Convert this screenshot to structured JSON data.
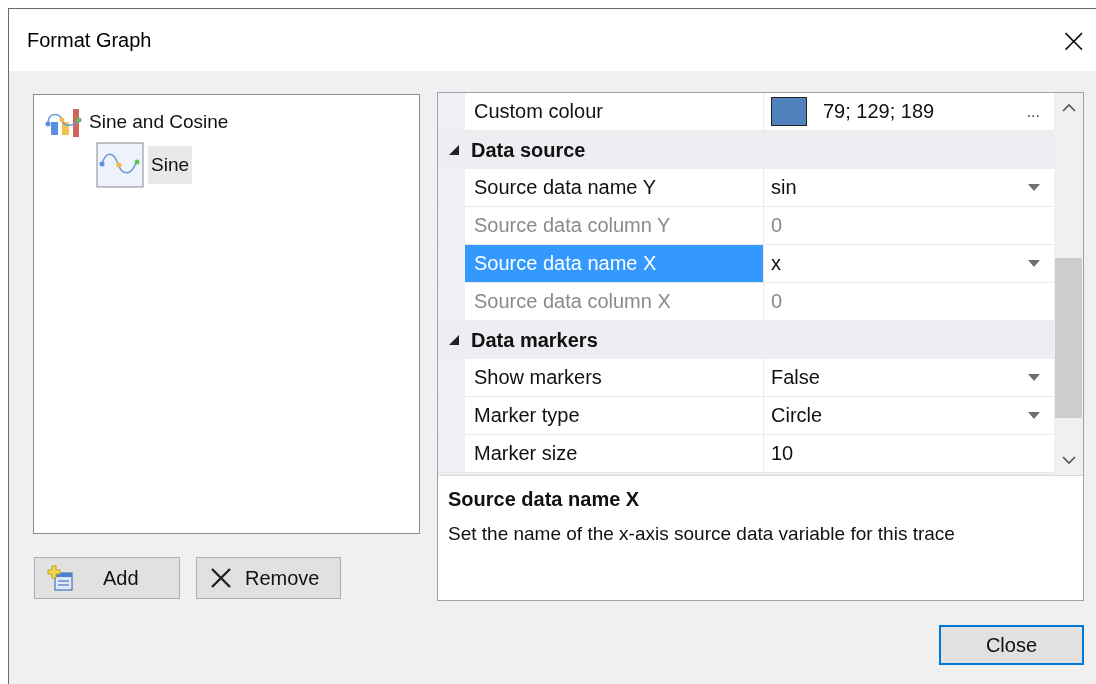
{
  "window": {
    "title": "Format Graph",
    "close": "×"
  },
  "tree": [
    {
      "kind": "graph",
      "label": "Sine and Cosine",
      "selected": false,
      "children": [
        {
          "kind": "trace",
          "label": "Sine",
          "selected": true
        }
      ]
    }
  ],
  "tree_buttons": [
    {
      "kind": "add",
      "label": "Add"
    },
    {
      "kind": "remove",
      "label": "Remove"
    }
  ],
  "properties": [
    {
      "kind": "color",
      "name": "Custom colour",
      "value": "79; 129; 189",
      "color": "#4f81bd",
      "ellipsis": "...",
      "disabled": false,
      "selected": false
    },
    {
      "kind": "category",
      "name": "Data source",
      "expanded": true
    },
    {
      "kind": "dropdown",
      "name": "Source data name Y",
      "value": "sin",
      "disabled": false,
      "selected": false
    },
    {
      "kind": "text",
      "name": "Source data column Y",
      "value": "0",
      "disabled": true,
      "selected": false
    },
    {
      "kind": "dropdown",
      "name": "Source data name X",
      "value": "x",
      "disabled": false,
      "selected": true
    },
    {
      "kind": "text",
      "name": "Source data column X",
      "value": "0",
      "disabled": true,
      "selected": false
    },
    {
      "kind": "category",
      "name": "Data markers",
      "expanded": true
    },
    {
      "kind": "dropdown",
      "name": "Show markers",
      "value": "False",
      "disabled": false,
      "selected": false
    },
    {
      "kind": "dropdown",
      "name": "Marker type",
      "value": "Circle",
      "disabled": false,
      "selected": false
    },
    {
      "kind": "text",
      "name": "Marker size",
      "value": "10",
      "disabled": false,
      "selected": false
    }
  ],
  "description": {
    "title": "Source data name X",
    "text": "Set the name of the x-axis source data variable for this trace"
  },
  "buttons": [
    "Close"
  ]
}
